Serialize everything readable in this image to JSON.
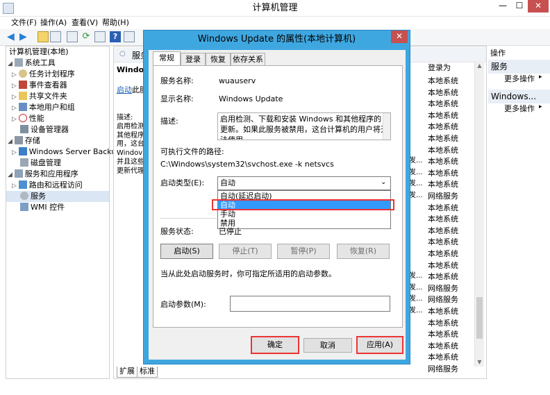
{
  "app": {
    "title": "计算机管理",
    "window_controls": {
      "minimize": "—",
      "maximize": "☐",
      "close": "✕"
    }
  },
  "menu": [
    "文件(F)",
    "操作(A)",
    "查看(V)",
    "帮助(H)"
  ],
  "tree": {
    "root": "计算机管理(本地)",
    "items": [
      {
        "label": "系统工具",
        "icon": "tools-icon",
        "level": 0
      },
      {
        "label": "任务计划程序",
        "icon": "clock-icon",
        "level": 1
      },
      {
        "label": "事件查看器",
        "icon": "event-viewer-icon",
        "level": 1
      },
      {
        "label": "共享文件夹",
        "icon": "folder-icon",
        "level": 1
      },
      {
        "label": "本地用户和组",
        "icon": "users-icon",
        "level": 1
      },
      {
        "label": "性能",
        "icon": "performance-icon",
        "level": 1
      },
      {
        "label": "设备管理器",
        "icon": "device-manager-icon",
        "level": 1
      },
      {
        "label": "存储",
        "icon": "storage-icon",
        "level": 0
      },
      {
        "label": "Windows Server Backup",
        "icon": "backup-icon",
        "level": 1
      },
      {
        "label": "磁盘管理",
        "icon": "disk-icon",
        "level": 1
      },
      {
        "label": "服务和应用程序",
        "icon": "services-apps-icon",
        "level": 0
      },
      {
        "label": "路由和远程访问",
        "icon": "routing-icon",
        "level": 1
      },
      {
        "label": "服务",
        "icon": "services-icon",
        "level": 1
      },
      {
        "label": "WMI 控件",
        "icon": "wmi-icon",
        "level": 1
      }
    ]
  },
  "mid": {
    "header": "服务",
    "selected_service": "Window",
    "link_text": "启动",
    "link_suffix": "此服",
    "desc_lines": [
      "描述:",
      "启用检测",
      "其他程序",
      "用，这台",
      "Windov",
      "并且这些",
      "更新代理"
    ],
    "col_logon": "登录为",
    "logon_as": [
      "本地系统",
      "本地系统",
      "本地系统",
      "本地系统",
      "本地系统",
      "本地系统",
      "本地系统",
      "本地系统",
      "本地系统",
      "本地系统",
      "网络服务",
      "本地系统",
      "本地系统",
      "本地系统",
      "本地系统",
      "本地系统",
      "本地系统",
      "本地系统",
      "网络服务",
      "网络服务",
      "本地系统",
      "本地系统",
      "本地系统",
      "本地系统",
      "本地系统",
      "网络服务"
    ],
    "side_fragments": [
      "发...",
      "发...",
      "发...",
      "发...",
      "发...",
      "发...",
      "发...",
      "发..."
    ],
    "tabs": [
      "扩展",
      "标准"
    ]
  },
  "actions": {
    "title": "操作",
    "sections": [
      {
        "head": "服务",
        "more": "更多操作"
      },
      {
        "head": "Windows...",
        "more": "更多操作"
      }
    ]
  },
  "dialog": {
    "title": "Windows Update 的属性(本地计算机)",
    "tabs": [
      "常规",
      "登录",
      "恢复",
      "依存关系"
    ],
    "service_name_label": "服务名称:",
    "service_name": "wuauserv",
    "display_name_label": "显示名称:",
    "display_name": "Windows Update",
    "description_label": "描述:",
    "description": "启用检测、下载和安装 Windows 和其他程序的更新。如果此服务被禁用，这台计算机的用户将无法使用",
    "exec_path_label": "可执行文件的路径:",
    "exec_path": "C:\\Windows\\system32\\svchost.exe -k netsvcs",
    "startup_type_label": "启动类型(E):",
    "startup_type_value": "自动",
    "startup_options": [
      "自动(延迟启动)",
      "自动",
      "手动",
      "禁用"
    ],
    "service_status_label": "服务状态:",
    "service_status": "已停止",
    "buttons": {
      "start": "启动(S)",
      "stop": "停止(T)",
      "pause": "暂停(P)",
      "resume": "恢复(R)"
    },
    "hint": "当从此处启动服务时，你可指定所适用的启动参数。",
    "start_params_label": "启动参数(M):",
    "ok": "确定",
    "cancel": "取消",
    "apply": "应用(A)"
  },
  "colors": {
    "dialog_frame": "#3fa7e0",
    "highlight": "#3399ff",
    "annotation": "#ee3333"
  }
}
